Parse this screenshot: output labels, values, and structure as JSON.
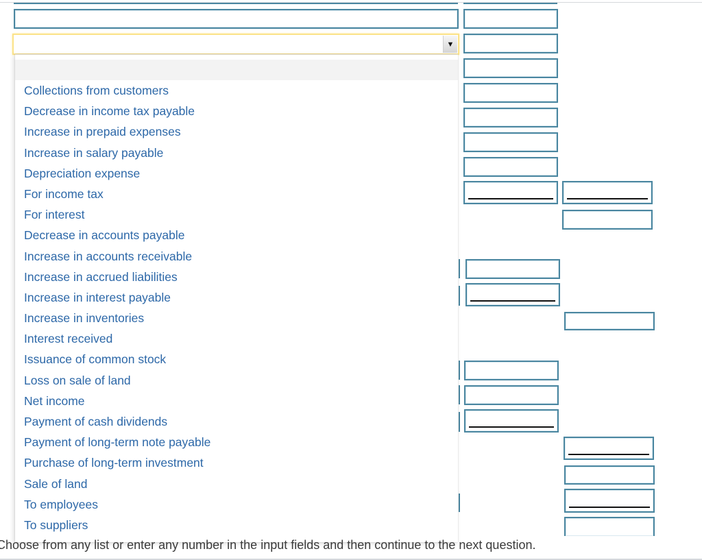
{
  "select": {
    "selected_value": "",
    "arrow_icon": "triangle-down-icon",
    "options": [
      "",
      "Collections from customers",
      "Decrease in income tax payable",
      "Increase in prepaid expenses",
      "Increase in salary payable",
      "Depreciation expense",
      "For income tax",
      "For interest",
      "Decrease in accounts payable",
      "Increase in accounts receivable",
      "Increase in accrued liabilities",
      "Increase in interest payable",
      "Increase in inventories",
      "Interest received",
      "Issuance of common stock",
      "Loss on sale of land",
      "Net income",
      "Payment of cash dividends",
      "Payment of long-term note payable",
      "Purchase of long-term investment",
      "Sale of land",
      "To employees",
      "To suppliers"
    ]
  },
  "inputs": {
    "label_input_value": "",
    "amount_values": [
      "",
      "",
      "",
      "",
      "",
      "",
      "",
      "",
      "",
      "",
      "",
      "",
      "",
      "",
      "",
      "",
      "",
      "",
      "",
      ""
    ]
  },
  "arrow_glyph": "▼",
  "footer": {
    "instruction": "Choose from any list or enter any number in the input fields and then continue to the next question."
  },
  "colors": {
    "input_border": "#4a86a0",
    "focus_border": "#fbe38a",
    "option_text": "#2d68a8"
  }
}
